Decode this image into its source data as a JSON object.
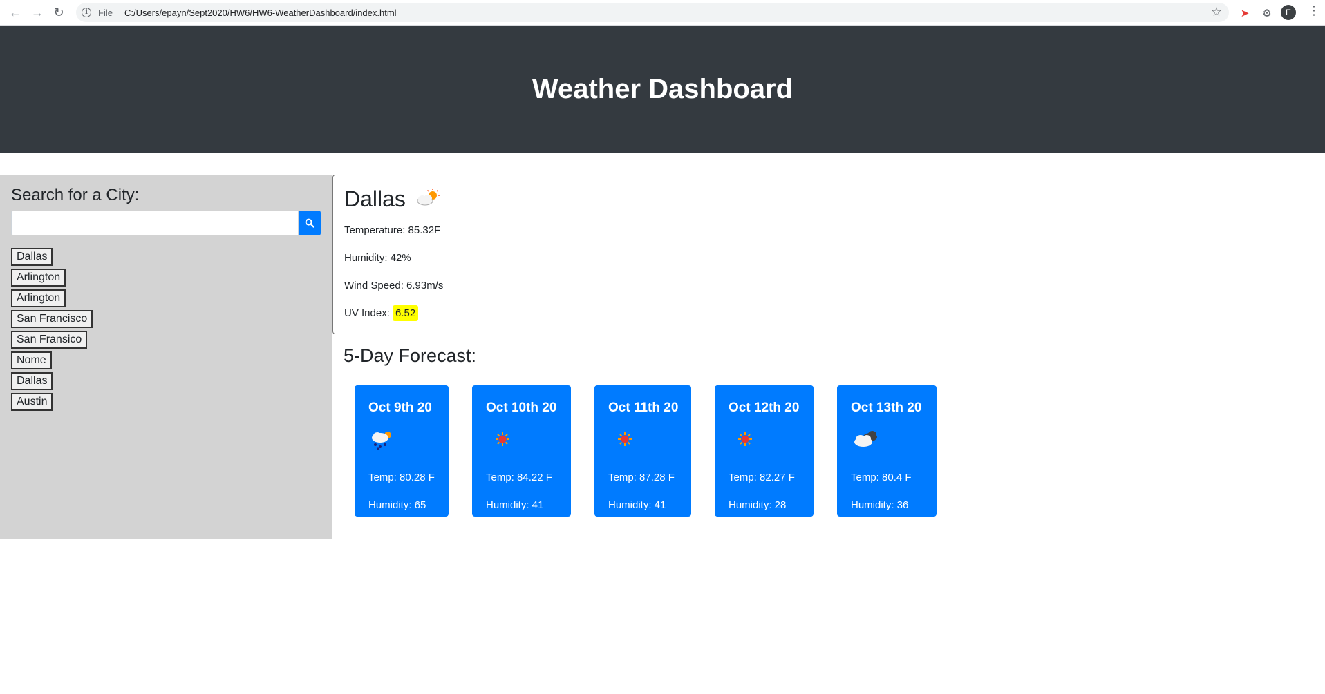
{
  "browser": {
    "file_label": "File",
    "url": "C:/Users/epayn/Sept2020/HW6/HW6-WeatherDashboard/index.html",
    "avatar_initial": "E"
  },
  "header": {
    "title": "Weather Dashboard"
  },
  "sidebar": {
    "heading": "Search for a City:",
    "search_value": "",
    "search_placeholder": "",
    "history": [
      "Dallas",
      "Arlington",
      "Arlington",
      "San Francisco",
      "San Fransico",
      "Nome",
      "Dallas",
      "Austin"
    ]
  },
  "current": {
    "city": "Dallas",
    "icon": "partly-cloudy-icon",
    "temperature": "Temperature: 85.32F",
    "humidity": "Humidity: 42%",
    "wind": "Wind Speed: 6.93m/s",
    "uv_label": "UV Index: ",
    "uv_value": "6.52",
    "uv_color": "#ffff00"
  },
  "forecast": {
    "title": "5-Day Forecast:",
    "accent": "#007bff",
    "days": [
      {
        "date": "Oct 9th 20",
        "icon": "rain-icon",
        "temp": "Temp: 80.28 F",
        "humidity": "Humidity: 65"
      },
      {
        "date": "Oct 10th 20",
        "icon": "sun-icon",
        "temp": "Temp: 84.22 F",
        "humidity": "Humidity: 41"
      },
      {
        "date": "Oct 11th 20",
        "icon": "sun-icon",
        "temp": "Temp: 87.28 F",
        "humidity": "Humidity: 41"
      },
      {
        "date": "Oct 12th 20",
        "icon": "sun-icon",
        "temp": "Temp: 82.27 F",
        "humidity": "Humidity: 28"
      },
      {
        "date": "Oct 13th 20",
        "icon": "cloudy-icon",
        "temp": "Temp: 80.4 F",
        "humidity": "Humidity: 36"
      }
    ]
  }
}
